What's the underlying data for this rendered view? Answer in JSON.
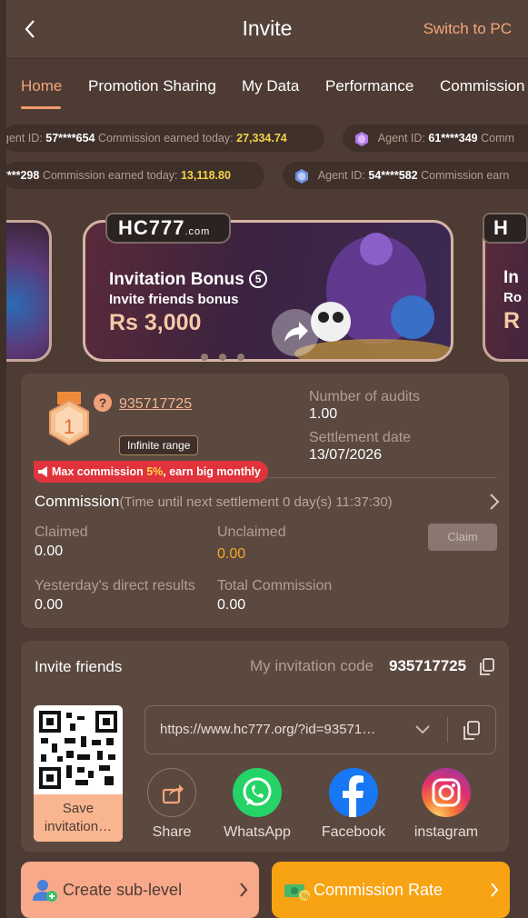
{
  "header": {
    "title": "Invite",
    "switch_label": "Switch to PC"
  },
  "tabs": [
    {
      "label": "Home",
      "active": true
    },
    {
      "label": "Promotion Sharing"
    },
    {
      "label": "My Data"
    },
    {
      "label": "Performance"
    },
    {
      "label": "Commission"
    }
  ],
  "ticker": {
    "row1": [
      {
        "agent_label": "gent ID:",
        "agent": "57****654",
        "earned_label": "Commission earned today:",
        "amount": "27,334.74"
      },
      {
        "agent_label": "Agent ID:",
        "agent": "61****349",
        "earned_label": "Comm"
      }
    ],
    "row2": [
      {
        "agent": "****298",
        "earned_label": "Commission earned today:",
        "amount": "13,118.80"
      },
      {
        "agent_label": "Agent ID:",
        "agent": "54****582",
        "earned_label": "Commission earn"
      }
    ]
  },
  "banner": {
    "logo": "HC777",
    "logo_suffix": ".com",
    "title": "Invitation Bonus",
    "badge": "5",
    "subtitle": "Invite friends bonus",
    "amount": "Rs 3,000",
    "right_peek": {
      "letter": "H",
      "title": "In",
      "sub": "Ro",
      "amt": "R"
    }
  },
  "commission_card": {
    "rank": "1",
    "account_id": "935717725",
    "range": "Infinite range",
    "audits_label": "Number of audits",
    "audits_value": "1.00",
    "settlement_label": "Settlement date",
    "settlement_value": "13/07/2026",
    "promo_pre": "Max commission",
    "promo_pct": "5%",
    "promo_post": ", earn big monthly",
    "commission_title": "Commission",
    "commission_sub": "(Time until next settlement  0 day(s) 11:37:30)",
    "claimed_label": "Claimed",
    "claimed_value": "0.00",
    "unclaimed_label": "Unclaimed",
    "unclaimed_value": "0.00",
    "claim_button": "Claim",
    "yesterday_label": "Yesterday's direct results",
    "yesterday_value": "0.00",
    "total_label": "Total Commission",
    "total_value": "0.00"
  },
  "invite": {
    "title": "Invite friends",
    "code_label": "My invitation code",
    "code": "935717725",
    "save_label": "Save invitation…",
    "url": "https://www.hc777.org/?id=93571…",
    "share": [
      {
        "label": "Share"
      },
      {
        "label": "WhatsApp"
      },
      {
        "label": "Facebook"
      },
      {
        "label": "instagram"
      }
    ]
  },
  "buttons": {
    "sub_level": "Create sub-level",
    "commission_rate": "Commission Rate"
  },
  "colors": {
    "accent": "#f49a6d",
    "background": "#4e3c34",
    "card": "#5b4940",
    "amount": "#f2d34a",
    "rate_button": "#f7a313"
  }
}
